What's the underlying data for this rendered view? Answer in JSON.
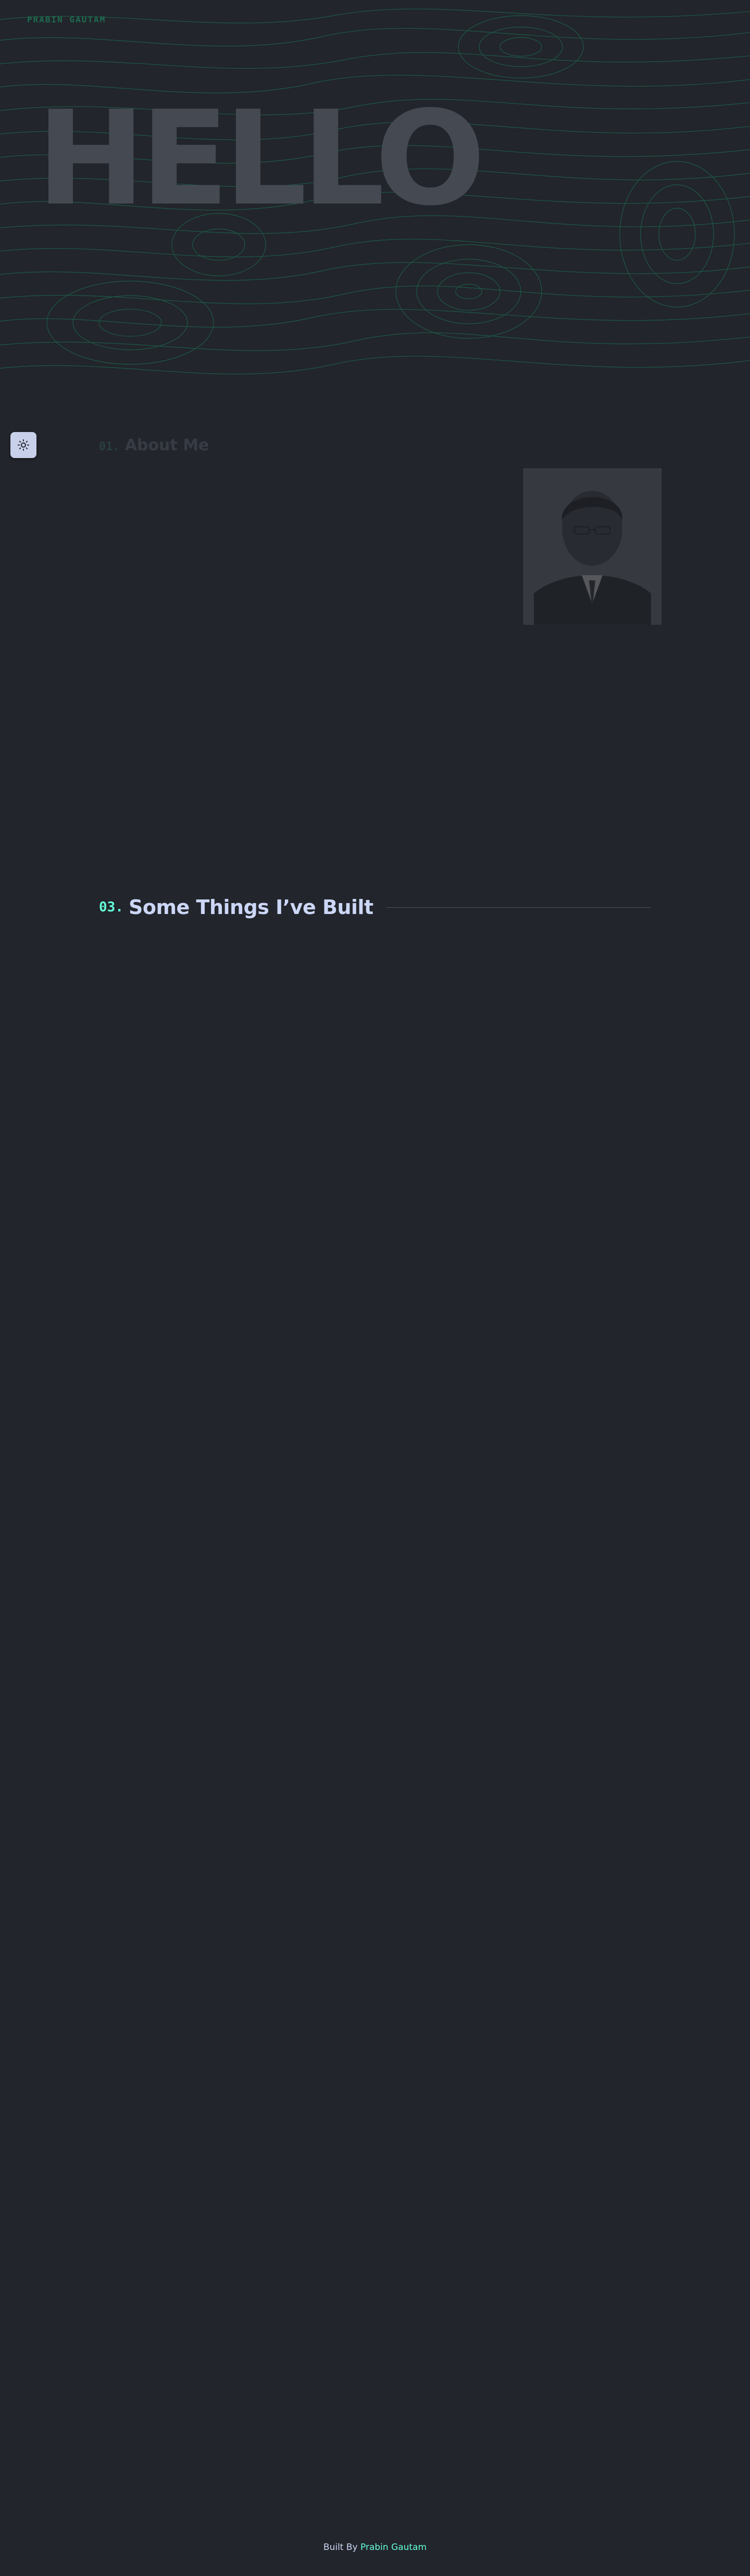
{
  "brand": {
    "name": "PRABIN GAUTAM"
  },
  "hero": {
    "title": "HELLO"
  },
  "theme_toggle": {
    "icon": "sun-icon"
  },
  "about": {
    "number": "01.",
    "title": "About Me"
  },
  "projects": {
    "number": "03.",
    "title": "Some Things I’ve Built"
  },
  "footer": {
    "prefix": "Built By",
    "author": "Prabin Gautam"
  },
  "colors": {
    "accent": "#64ffda",
    "background": "#22252b",
    "text": "#ccd6f6",
    "topo_lines": "#1c6b52"
  }
}
